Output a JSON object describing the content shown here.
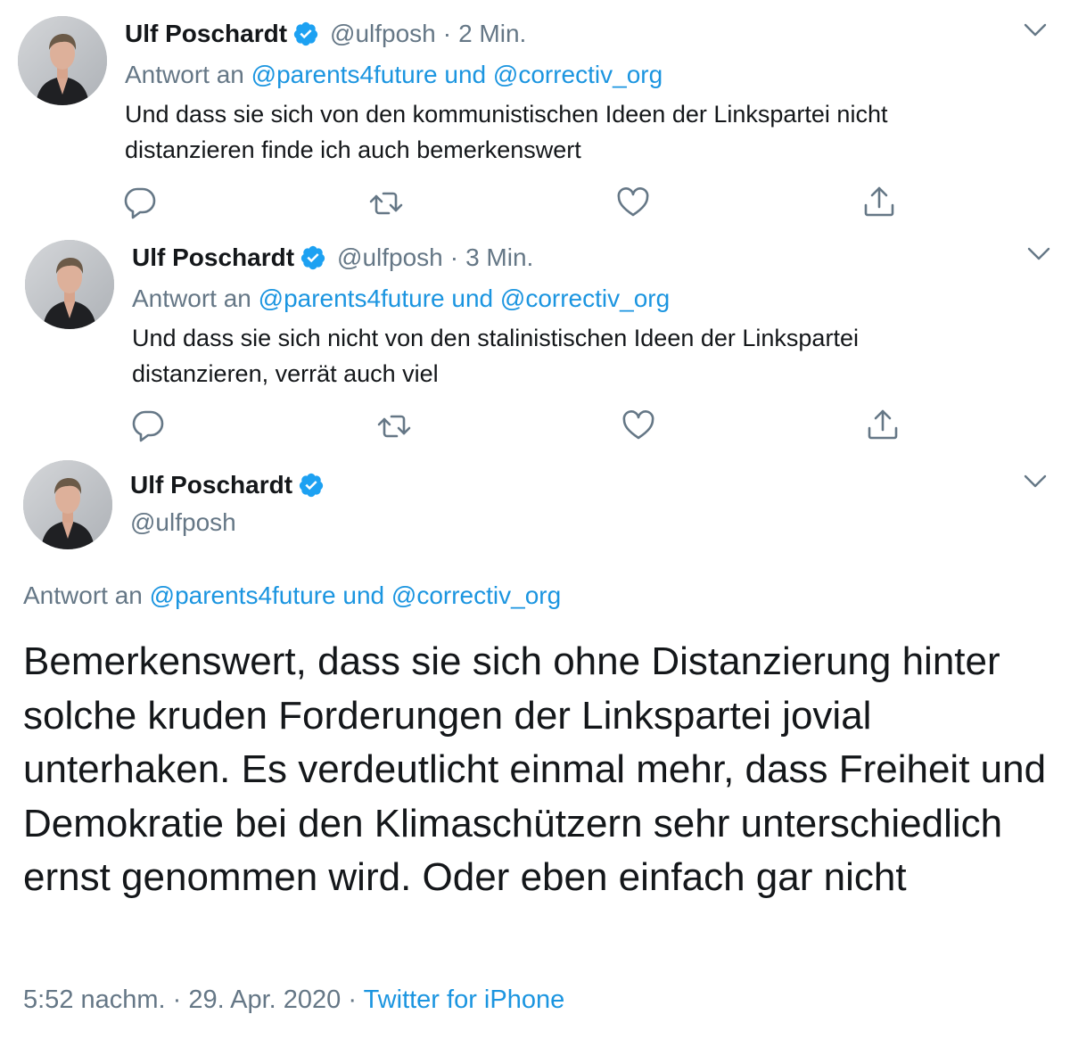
{
  "tweets": [
    {
      "name": "Ulf Poschardt",
      "handle": "@ulfposh",
      "separator": "·",
      "time": "2 Min.",
      "reply_prefix": "Antwort an",
      "reply_mentions": "@parents4future und @correctiv_org",
      "text": "Und dass sie sich von den kommunistischen Ideen der Linkspartei nicht distanzieren finde ich auch bemerkenswert"
    },
    {
      "name": "Ulf Poschardt",
      "handle": "@ulfposh",
      "separator": "·",
      "time": "3 Min.",
      "reply_prefix": "Antwort an",
      "reply_mentions": "@parents4future und @correctiv_org",
      "text": "Und dass sie sich nicht von den stalinistischen Ideen der Linkspartei distanzieren, verrät auch viel"
    }
  ],
  "main": {
    "name": "Ulf Poschardt",
    "handle": "@ulfposh",
    "reply_prefix": "Antwort an",
    "reply_mentions": "@parents4future und @correctiv_org",
    "text": "Bemerkenswert, dass sie sich ohne Distanzierung hinter solche kruden Forderungen der Linkspartei jovial unterhaken. Es verdeutlicht einmal mehr, dass Freiheit und Demokratie bei den Klimaschützern sehr unterschiedlich ernst genommen wird. Oder eben einfach gar nicht",
    "timestamp": "5:52 nachm. · 29. Apr. 2020 ·",
    "source": "Twitter for iPhone"
  },
  "icons": {
    "verified": "verified-badge-icon",
    "reply": "reply-icon",
    "retweet": "retweet-icon",
    "like": "like-icon",
    "share": "share-icon",
    "more": "chevron-down-icon"
  },
  "colors": {
    "link": "#1b95e0",
    "secondary_text": "#657786",
    "verified": "#1da1f2",
    "primary_text": "#14171a"
  }
}
